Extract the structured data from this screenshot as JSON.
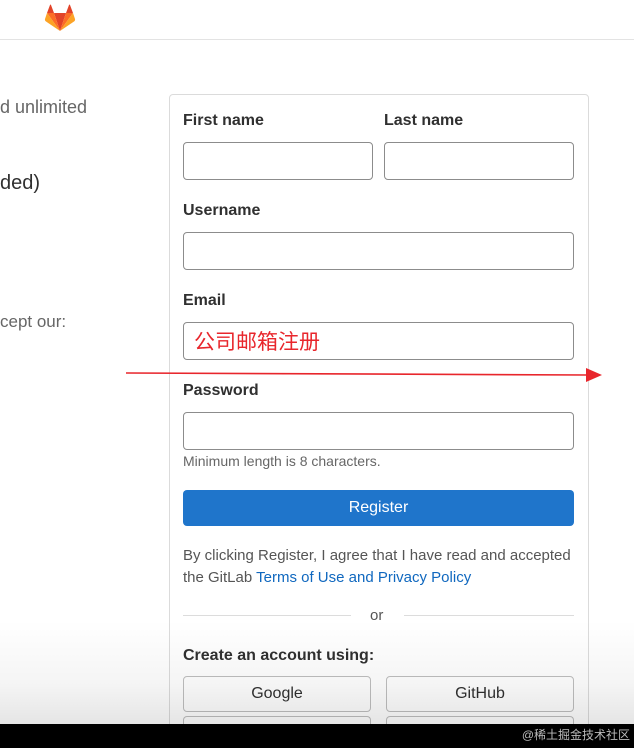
{
  "left_panel": {
    "line1": "d unlimited",
    "line2": "ded)",
    "line3": "cept our:"
  },
  "form": {
    "first_name_label": "First name",
    "last_name_label": "Last name",
    "username_label": "Username",
    "email_label": "Email",
    "email_value": "公司邮箱注册",
    "password_label": "Password",
    "password_hint": "Minimum length is 8 characters.",
    "register_label": "Register",
    "terms_prefix": "By clicking Register, I agree that I have read and accepted the GitLab ",
    "terms_link": "Terms of Use and Privacy Policy",
    "or_label": "or",
    "oauth_title": "Create an account using:",
    "google_label": "Google",
    "github_label": "GitHub"
  },
  "annotation": {
    "arrow_color": "#e8262c"
  },
  "colors": {
    "brand_orange": "#fc6d26",
    "primary_blue": "#1f75cb",
    "link_blue": "#1068bf",
    "annotation_red": "#e8262c"
  },
  "watermark": "@稀土掘金技术社区"
}
